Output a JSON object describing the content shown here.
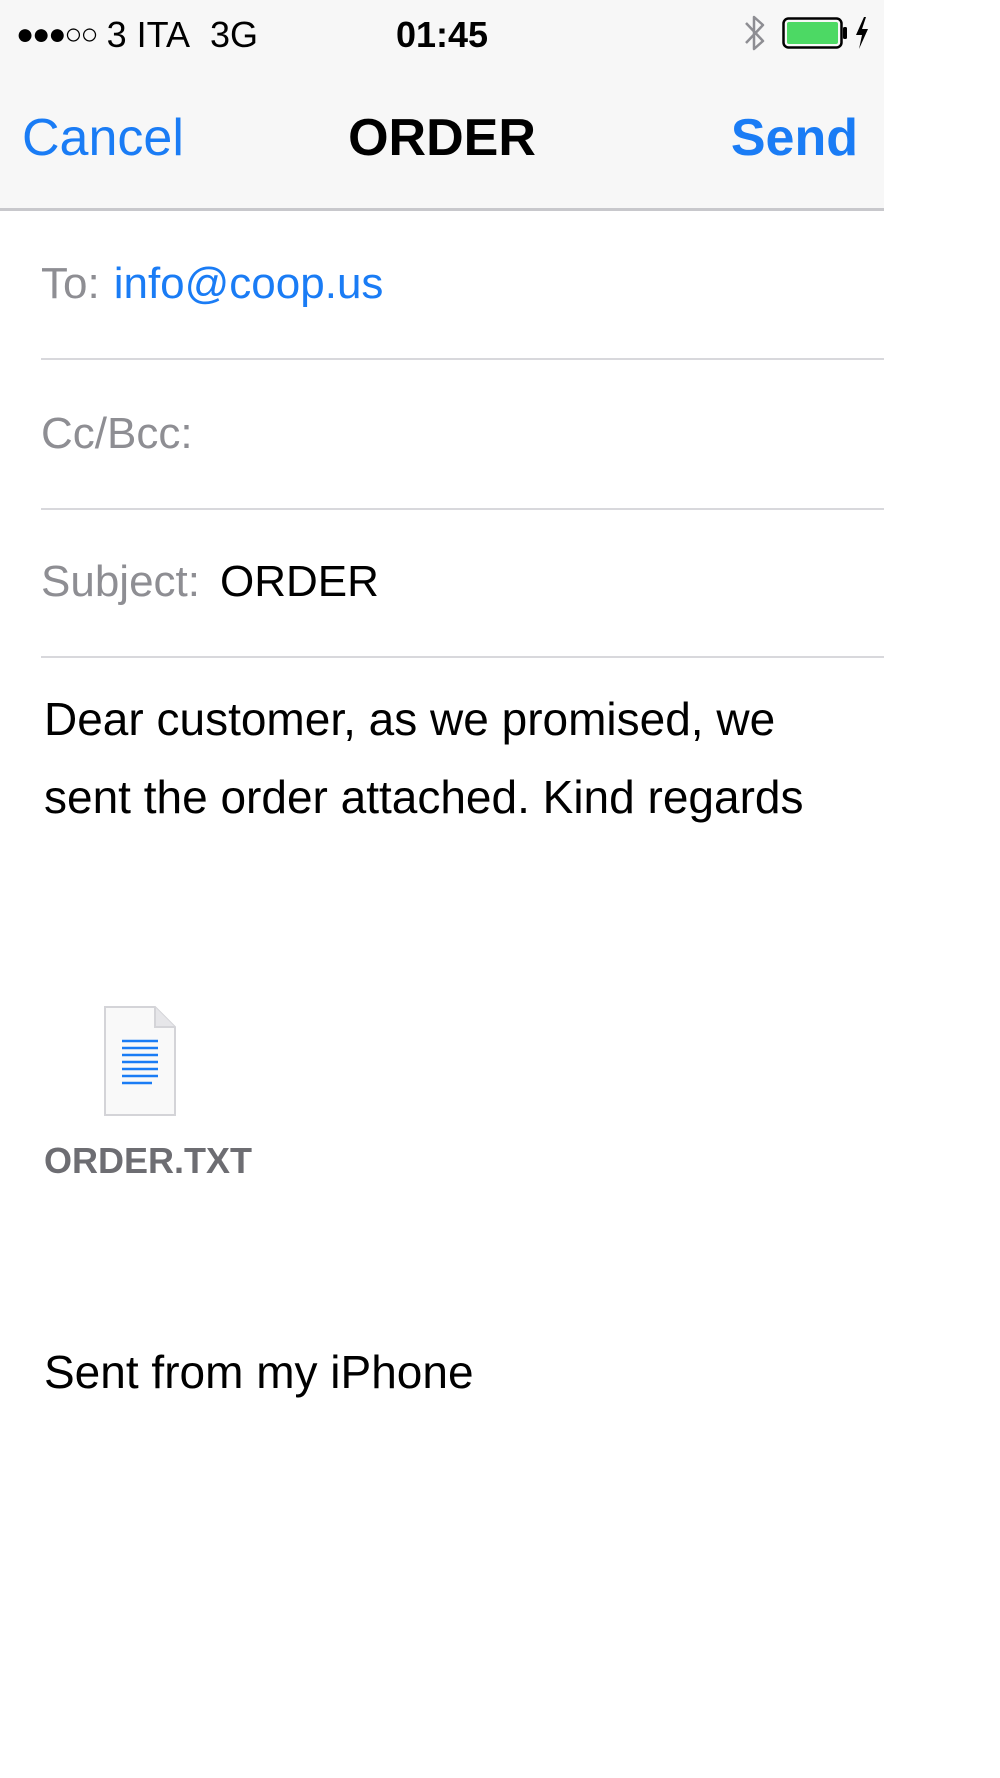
{
  "status_bar": {
    "signal": "●●●○○",
    "carrier": "3 ITA",
    "network": "3G",
    "time": "01:45",
    "bluetooth_icon": "bluetooth-icon",
    "battery_icon": "battery-charging-icon",
    "battery_color": "#4cd964"
  },
  "nav": {
    "cancel_label": "Cancel",
    "title": "ORDER",
    "send_label": "Send",
    "accent_color": "#1a7cf5"
  },
  "fields": {
    "to_label": "To:",
    "to_value": "info@coop.us",
    "cc_label": "Cc/Bcc:",
    "subject_label": "Subject:",
    "subject_value": "ORDER"
  },
  "body": {
    "line1": "Dear customer, as we promised, we",
    "line2": "sent the order attached. Kind regards"
  },
  "attachment": {
    "icon": "text-document-icon",
    "filename": "ORDER.TXT"
  },
  "signature": "Sent from my iPhone"
}
